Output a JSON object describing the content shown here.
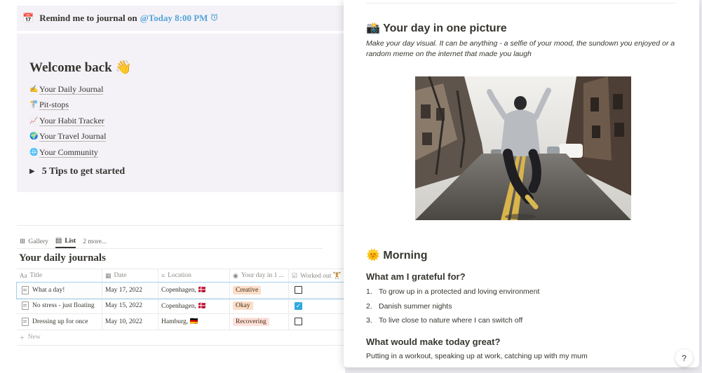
{
  "reminder": {
    "icon": "calendar-icon",
    "text": "Remind me to journal on",
    "mention": "@Today 8:00 PM",
    "alarm_icon": "alarm-clock-icon"
  },
  "welcome": {
    "title": "Welcome back 👋",
    "links": [
      {
        "icon": "✍️",
        "label": "Your Daily Journal"
      },
      {
        "icon": "🚏",
        "label": "Pit-stops"
      },
      {
        "icon": "📈",
        "label": "Your Habit Tracker"
      },
      {
        "icon": "🌍",
        "label": "Your Travel Journal"
      },
      {
        "icon": "🌐",
        "label": "Your Community"
      }
    ],
    "toggle": "5 Tips to get started"
  },
  "views": {
    "tabs": [
      "Gallery",
      "List"
    ],
    "more": "2 more..."
  },
  "database": {
    "title": "Your daily journals",
    "columns": [
      "Title",
      "Date",
      "Location",
      "Your day in 1 ...",
      "Worked out 🏋"
    ],
    "rows": [
      {
        "title": "What a day!",
        "date": "May 17, 2022",
        "location": "Copenhagen, 🇩🇰",
        "mood": "Creative",
        "worked_out": false
      },
      {
        "title": "No stress - just floating",
        "date": "May 15, 2022",
        "location": "Copenhagen, 🇩🇰",
        "mood": "Okay",
        "worked_out": true
      },
      {
        "title": "Dressing up for once",
        "date": "May 10, 2022",
        "location": "Hamburg, 🇩🇪",
        "mood": "Recovering",
        "worked_out": false
      }
    ],
    "new_label": "New"
  },
  "panel": {
    "picture_title": "📸 Your day in one picture",
    "picture_desc": "Make your day visual. It can be anything - a selfie of your mood, the sundown you enjoyed or a random meme on the internet that made you laugh",
    "morning_title": "🌞 Morning",
    "grateful_title": "What am I grateful for?",
    "grateful_items": [
      "To grow up in a protected and loving environment",
      "Danish summer nights",
      "To live close to nature where I can switch off"
    ],
    "great_title": "What would make today great?",
    "great_text": "Putting in a workout, speaking up at work, catching up with my mum"
  },
  "help_label": "?",
  "colors": {
    "callout_bg": "#f4f2f7",
    "mention": "#54a3d8",
    "tag_creative": "#fadec9",
    "tag_okay": "#fadec9",
    "tag_recovering": "#ffe2dd",
    "checkbox_on": "#2eaadc"
  }
}
